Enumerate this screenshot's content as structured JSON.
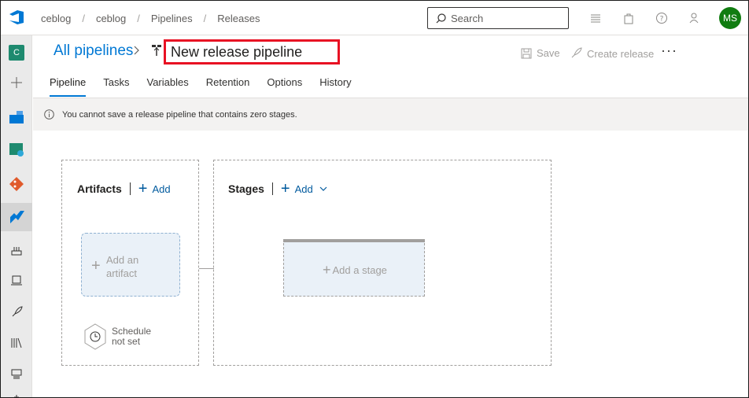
{
  "topbar": {
    "breadcrumbs": [
      "ceblog",
      "ceblog",
      "Pipelines",
      "Releases"
    ],
    "search_placeholder": "Search",
    "avatar_initials": "MS",
    "avatar_color": "#107c10"
  },
  "rail": {
    "project_initial": "C",
    "items": [
      "project",
      "add",
      "boards",
      "test-plans",
      "repos",
      "pipelines",
      "deployment-groups",
      "environments",
      "releases",
      "library",
      "task-groups",
      "more"
    ]
  },
  "header": {
    "all_pipelines_label": "All pipelines",
    "pipeline_name": "New release pipeline",
    "save_label": "Save",
    "create_release_label": "Create release",
    "more_label": "···"
  },
  "tabs": [
    {
      "label": "Pipeline",
      "active": true
    },
    {
      "label": "Tasks",
      "active": false
    },
    {
      "label": "Variables",
      "active": false
    },
    {
      "label": "Retention",
      "active": false
    },
    {
      "label": "Options",
      "active": false
    },
    {
      "label": "History",
      "active": false
    }
  ],
  "info": {
    "message": "You cannot save a release pipeline that contains zero stages."
  },
  "artifacts": {
    "title": "Artifacts",
    "add_label": "Add",
    "add_artifact_line1": "Add an",
    "add_artifact_line2": "artifact",
    "schedule_line1": "Schedule",
    "schedule_line2": "not set"
  },
  "stages": {
    "title": "Stages",
    "add_label": "Add",
    "add_stage_label": "Add a stage"
  },
  "colors": {
    "accent": "#0078d4",
    "highlight_border": "#e81123"
  }
}
